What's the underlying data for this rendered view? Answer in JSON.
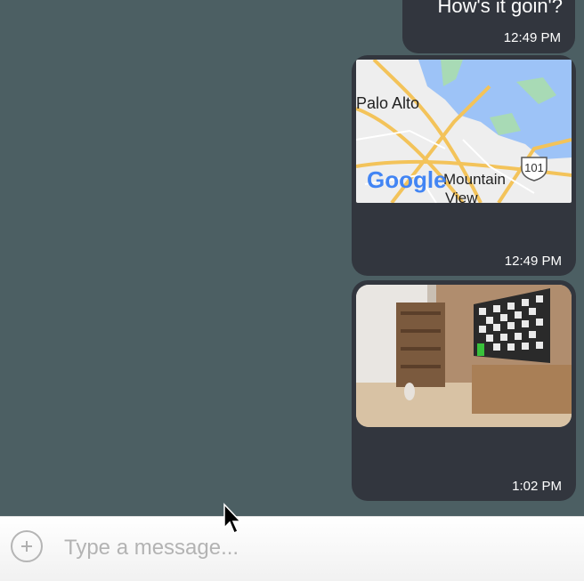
{
  "messages": [
    {
      "type": "text",
      "text": "How's it goin'?",
      "time": "12:49 PM"
    },
    {
      "type": "map",
      "time": "12:49 PM",
      "map_labels": {
        "city1": "Palo Alto",
        "city2a": "Mountain",
        "city2b": "View",
        "highway": "101",
        "logo": "Google"
      }
    },
    {
      "type": "image",
      "time": "1:02 PM"
    }
  ],
  "composer": {
    "placeholder": "Type a message..."
  },
  "colors": {
    "background": "#4c5f63",
    "bubble": "#32363e",
    "text": "#ffffff"
  }
}
